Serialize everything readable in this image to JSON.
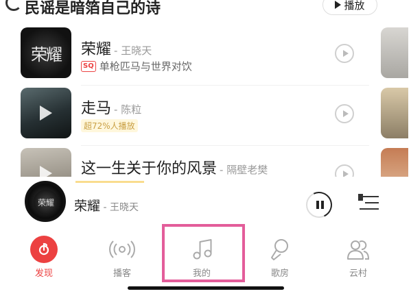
{
  "header": {
    "title": "民谣是暗箔自己的诗",
    "play_all_label": "播放"
  },
  "songs": [
    {
      "title": "荣耀",
      "artist": "- 王晓天",
      "cover_text": "荣耀",
      "quality_badge": "SQ",
      "subtitle": "单枪匹马与世界对饮"
    },
    {
      "title": "走马",
      "artist": "- 陈粒",
      "cover_text": "",
      "hot_text": "超72%人播放"
    },
    {
      "title": "这一生关于你的风景",
      "artist": "- 隔壁老樊",
      "cover_text": ""
    }
  ],
  "mini_player": {
    "title": "荣耀",
    "artist": " - 王晓天",
    "disc_text": "荣耀"
  },
  "tabbar": {
    "tabs": [
      {
        "label": "发现",
        "icon": "discover-icon",
        "active": true
      },
      {
        "label": "播客",
        "icon": "podcast-icon",
        "active": false
      },
      {
        "label": "我的",
        "icon": "music-note-icon",
        "active": false
      },
      {
        "label": "歌房",
        "icon": "microphone-icon",
        "active": false
      },
      {
        "label": "云村",
        "icon": "community-icon",
        "active": false
      }
    ]
  },
  "colors": {
    "accent": "#ec4141",
    "highlight_box": "#e35d9a"
  }
}
